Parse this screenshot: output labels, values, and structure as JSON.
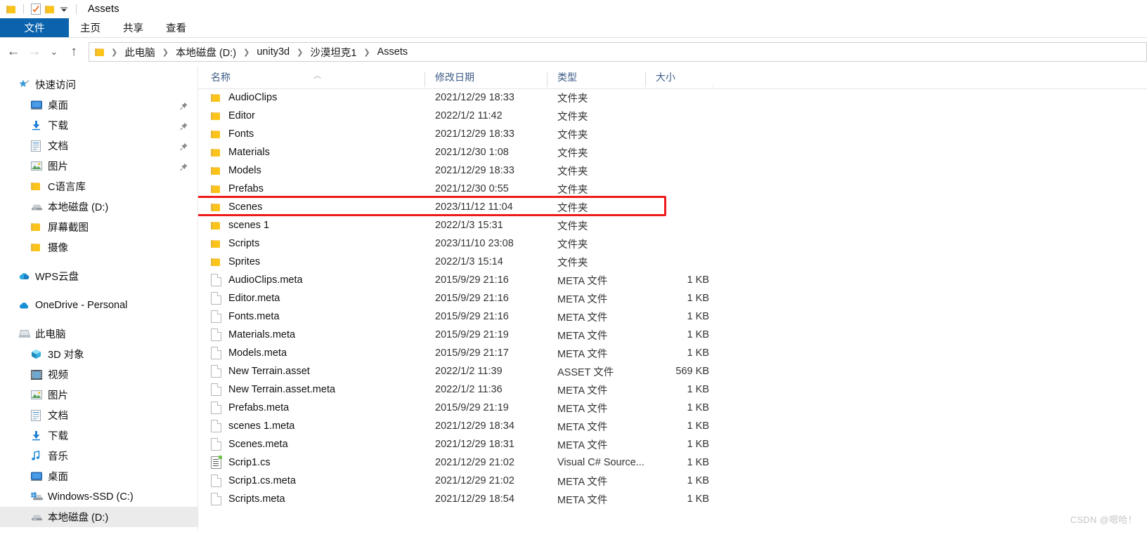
{
  "window": {
    "title": "Assets",
    "qat": [
      {
        "name": "folder-icon",
        "label": "folder"
      },
      {
        "name": "properties-icon",
        "label": "properties"
      },
      {
        "name": "new-folder-icon",
        "label": "new folder"
      },
      {
        "name": "chevron-down-icon",
        "label": "customize"
      }
    ]
  },
  "ribbon": {
    "tabs": [
      {
        "label": "文件",
        "active": true
      },
      {
        "label": "主页",
        "active": false
      },
      {
        "label": "共享",
        "active": false
      },
      {
        "label": "查看",
        "active": false
      }
    ]
  },
  "nav": {
    "back": "←",
    "forward": "→",
    "recent": "⌄",
    "up": "↑",
    "breadcrumbs": [
      "此电脑",
      "本地磁盘 (D:)",
      "unity3d",
      "沙漠坦克1",
      "Assets"
    ],
    "separator": "❯"
  },
  "sidebar": {
    "groups": [
      {
        "header": {
          "label": "快速访问",
          "icon": "star-pin-icon"
        },
        "items": [
          {
            "label": "桌面",
            "icon": "desktop-icon",
            "pinned": true
          },
          {
            "label": "下载",
            "icon": "download-icon",
            "pinned": true
          },
          {
            "label": "文档",
            "icon": "documents-icon",
            "pinned": true
          },
          {
            "label": "图片",
            "icon": "pictures-icon",
            "pinned": true
          },
          {
            "label": "C语言库",
            "icon": "folder-icon",
            "pinned": false
          },
          {
            "label": "本地磁盘 (D:)",
            "icon": "drive-icon",
            "pinned": false
          },
          {
            "label": "屏幕截图",
            "icon": "folder-icon",
            "pinned": false
          },
          {
            "label": "摄像",
            "icon": "folder-icon",
            "pinned": false
          }
        ]
      },
      {
        "header": {
          "label": "WPS云盘",
          "icon": "wps-cloud-icon"
        },
        "items": []
      },
      {
        "header": {
          "label": "OneDrive - Personal",
          "icon": "onedrive-icon"
        },
        "items": []
      },
      {
        "header": {
          "label": "此电脑",
          "icon": "this-pc-icon"
        },
        "items": [
          {
            "label": "3D 对象",
            "icon": "3d-objects-icon",
            "pinned": false
          },
          {
            "label": "视频",
            "icon": "videos-icon",
            "pinned": false
          },
          {
            "label": "图片",
            "icon": "pictures-icon",
            "pinned": false
          },
          {
            "label": "文档",
            "icon": "documents-icon",
            "pinned": false
          },
          {
            "label": "下载",
            "icon": "download-icon",
            "pinned": false
          },
          {
            "label": "音乐",
            "icon": "music-icon",
            "pinned": false
          },
          {
            "label": "桌面",
            "icon": "desktop-icon",
            "pinned": false
          },
          {
            "label": "Windows-SSD (C:)",
            "icon": "windows-drive-icon",
            "pinned": false
          },
          {
            "label": "本地磁盘 (D:)",
            "icon": "drive-icon",
            "pinned": false,
            "selected": true
          }
        ]
      }
    ]
  },
  "list": {
    "columns": [
      {
        "label": "名称",
        "key": "name"
      },
      {
        "label": "修改日期",
        "key": "date"
      },
      {
        "label": "类型",
        "key": "type"
      },
      {
        "label": "大小",
        "key": "size"
      }
    ],
    "sort": {
      "column": "名称",
      "direction": "asc",
      "glyph": "︿"
    },
    "rows": [
      {
        "name": "AudioClips",
        "date": "2021/12/29 18:33",
        "type": "文件夹",
        "size": "",
        "icon": "folder-icon"
      },
      {
        "name": "Editor",
        "date": "2022/1/2 11:42",
        "type": "文件夹",
        "size": "",
        "icon": "folder-icon"
      },
      {
        "name": "Fonts",
        "date": "2021/12/29 18:33",
        "type": "文件夹",
        "size": "",
        "icon": "folder-icon"
      },
      {
        "name": "Materials",
        "date": "2021/12/30 1:08",
        "type": "文件夹",
        "size": "",
        "icon": "folder-icon"
      },
      {
        "name": "Models",
        "date": "2021/12/29 18:33",
        "type": "文件夹",
        "size": "",
        "icon": "folder-icon"
      },
      {
        "name": "Prefabs",
        "date": "2021/12/30 0:55",
        "type": "文件夹",
        "size": "",
        "icon": "folder-icon"
      },
      {
        "name": "Scenes",
        "date": "2023/11/12 11:04",
        "type": "文件夹",
        "size": "",
        "icon": "folder-icon",
        "highlighted": true
      },
      {
        "name": "scenes 1",
        "date": "2022/1/3 15:31",
        "type": "文件夹",
        "size": "",
        "icon": "folder-icon"
      },
      {
        "name": "Scripts",
        "date": "2023/11/10 23:08",
        "type": "文件夹",
        "size": "",
        "icon": "folder-icon"
      },
      {
        "name": "Sprites",
        "date": "2022/1/3 15:14",
        "type": "文件夹",
        "size": "",
        "icon": "folder-icon"
      },
      {
        "name": "AudioClips.meta",
        "date": "2015/9/29 21:16",
        "type": "META 文件",
        "size": "1 KB",
        "icon": "file-icon"
      },
      {
        "name": "Editor.meta",
        "date": "2015/9/29 21:16",
        "type": "META 文件",
        "size": "1 KB",
        "icon": "file-icon"
      },
      {
        "name": "Fonts.meta",
        "date": "2015/9/29 21:16",
        "type": "META 文件",
        "size": "1 KB",
        "icon": "file-icon"
      },
      {
        "name": "Materials.meta",
        "date": "2015/9/29 21:19",
        "type": "META 文件",
        "size": "1 KB",
        "icon": "file-icon"
      },
      {
        "name": "Models.meta",
        "date": "2015/9/29 21:17",
        "type": "META 文件",
        "size": "1 KB",
        "icon": "file-icon"
      },
      {
        "name": "New Terrain.asset",
        "date": "2022/1/2 11:39",
        "type": "ASSET 文件",
        "size": "569 KB",
        "icon": "file-icon"
      },
      {
        "name": "New Terrain.asset.meta",
        "date": "2022/1/2 11:36",
        "type": "META 文件",
        "size": "1 KB",
        "icon": "file-icon"
      },
      {
        "name": "Prefabs.meta",
        "date": "2015/9/29 21:19",
        "type": "META 文件",
        "size": "1 KB",
        "icon": "file-icon"
      },
      {
        "name": "scenes 1.meta",
        "date": "2021/12/29 18:34",
        "type": "META 文件",
        "size": "1 KB",
        "icon": "file-icon"
      },
      {
        "name": "Scenes.meta",
        "date": "2021/12/29 18:31",
        "type": "META 文件",
        "size": "1 KB",
        "icon": "file-icon"
      },
      {
        "name": "Scrip1.cs",
        "date": "2021/12/29 21:02",
        "type": "Visual C# Source...",
        "size": "1 KB",
        "icon": "csharp-file-icon"
      },
      {
        "name": "Scrip1.cs.meta",
        "date": "2021/12/29 21:02",
        "type": "META 文件",
        "size": "1 KB",
        "icon": "file-icon"
      },
      {
        "name": "Scripts.meta",
        "date": "2021/12/29 18:54",
        "type": "META 文件",
        "size": "1 KB",
        "icon": "file-icon"
      }
    ]
  },
  "annotation": {
    "color": "#ef1a1a",
    "target_row": "Scenes"
  },
  "watermark": {
    "text": "CSDN @嗯哈！"
  },
  "colors": {
    "accent": "#0b63ad",
    "header_text": "#3c5c86",
    "folder": "#fcc419",
    "highlight": "#ef1a1a"
  }
}
